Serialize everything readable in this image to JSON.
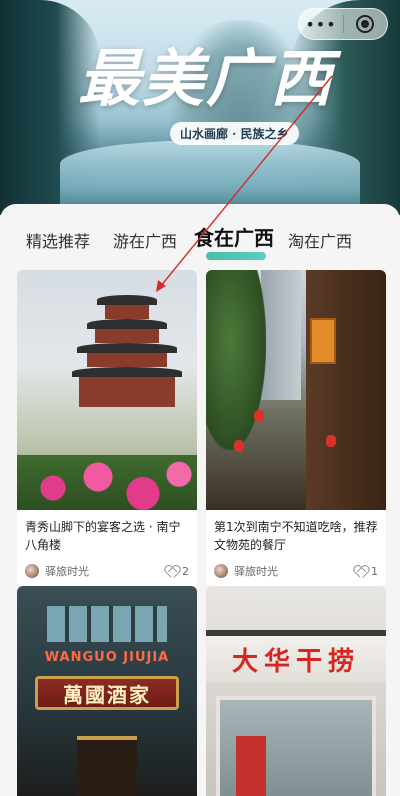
{
  "hero": {
    "title": "最美广西",
    "subtitle": "山水画廊 · 民族之乡"
  },
  "capsule": {
    "more_label": "•••",
    "close_icon": "target-icon"
  },
  "tabs": [
    {
      "label": "精选推荐",
      "active": false
    },
    {
      "label": "游在广西",
      "active": false
    },
    {
      "label": "食在广西",
      "active": true
    },
    {
      "label": "淘在广西",
      "active": false
    }
  ],
  "cards": [
    {
      "title": "青秀山脚下的宴客之选 · 南宁八角楼",
      "author": "驿旅时光",
      "likes": "2"
    },
    {
      "title": "第1次到南宁不知道吃啥，推荐文物苑的餐厅",
      "author": "驿旅时光",
      "likes": "1"
    },
    {
      "sign_top": "WANGUO JIUJIA",
      "sign_main": "萬國酒家"
    },
    {
      "sign_main": "大华干捞"
    }
  ],
  "colors": {
    "accent_underline": "#2db3a0",
    "sign_red": "#d7261f"
  }
}
